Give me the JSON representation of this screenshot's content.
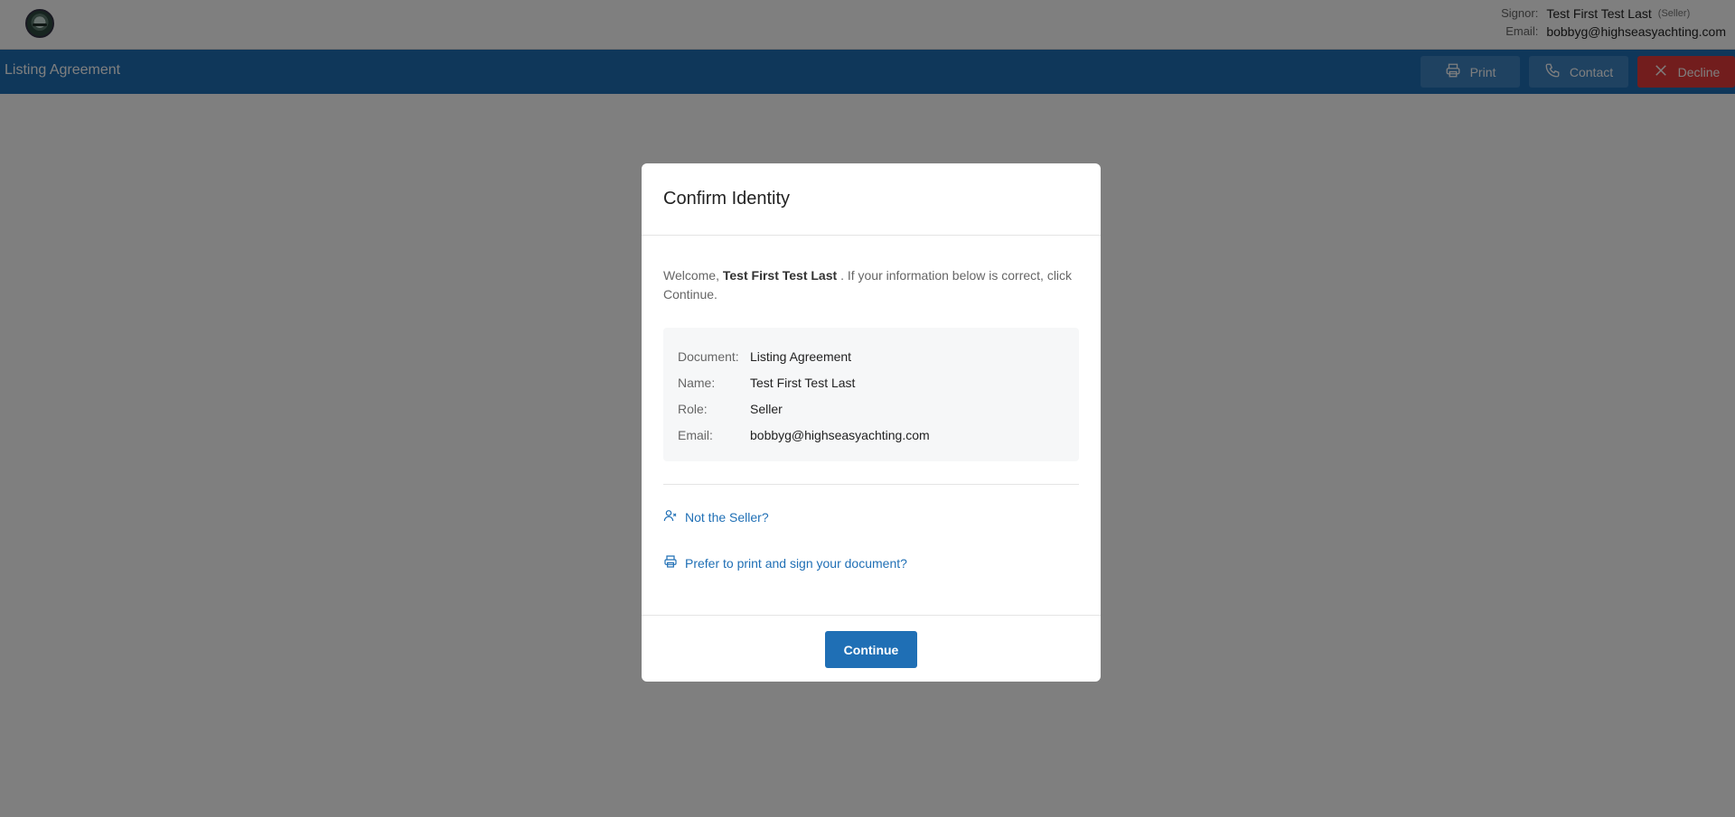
{
  "header": {
    "signor_label": "Signor:",
    "signor_name": "Test First Test Last",
    "signor_role": "(Seller)",
    "email_label": "Email:",
    "email": "bobbyg@highseasyachting.com"
  },
  "titlebar": {
    "title": "Listing Agreement",
    "print_label": "Print",
    "contact_label": "Contact",
    "decline_label": "Decline"
  },
  "modal": {
    "title": "Confirm Identity",
    "welcome_prefix": "Welcome,",
    "welcome_name": "Test First Test Last",
    "welcome_suffix": ". If your information below is correct, click Continue.",
    "fields": [
      {
        "label": "Document:",
        "value": "Listing Agreement"
      },
      {
        "label": "Name:",
        "value": "Test First Test Last"
      },
      {
        "label": "Role:",
        "value": "Seller"
      },
      {
        "label": "Email:",
        "value": "bobbyg@highseasyachting.com"
      }
    ],
    "not_role_link": "Not the Seller?",
    "print_link": "Prefer to print and sign your document?",
    "continue_label": "Continue"
  },
  "colors": {
    "primary": "#1f6fb5",
    "decline": "#e53a3a"
  }
}
